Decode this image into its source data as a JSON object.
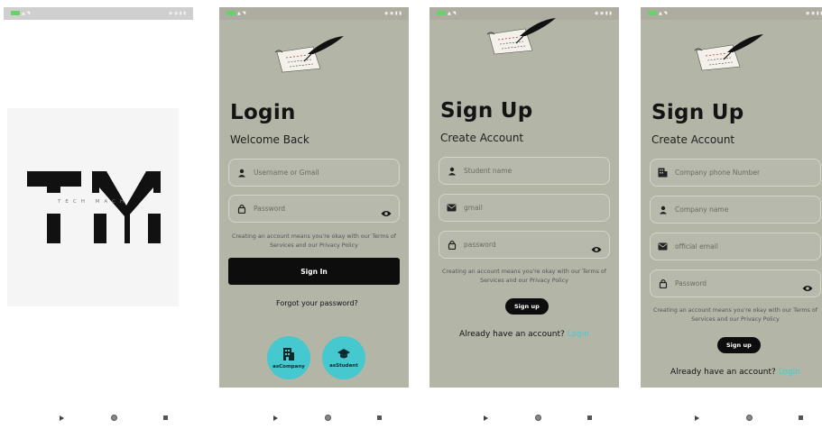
{
  "splash": {
    "brand": "TECH MACH"
  },
  "login": {
    "title": "Login",
    "subtitle": "Welcome Back",
    "username_placeholder": "Username or Gmail",
    "password_placeholder": "Password",
    "terms": "Creating an account means you're okay with our Terms of Services and our Privacy Policy",
    "signin_label": "Sign In",
    "forgot_label": "Forgot your password?",
    "company_label": "asCompany",
    "student_label": "asStudent"
  },
  "signup_student": {
    "title": "Sign Up",
    "subtitle": "Create Account",
    "name_placeholder": "Student name",
    "gmail_placeholder": "gmail",
    "password_placeholder": "password",
    "terms": "Creating an account means you're okay with our Terms of Services and our Privacy Policy",
    "signup_label": "Sign up",
    "already_text": "Already have an account?",
    "login_link": "Login"
  },
  "signup_company": {
    "title": "Sign Up",
    "subtitle": "Create Account",
    "phone_placeholder": "Company phone Number",
    "name_placeholder": "Company name",
    "email_placeholder": "official email",
    "password_placeholder": "Password",
    "terms": "Creating an account means you're okay with our Terms of Services and our Privacy Policy",
    "signup_label": "Sign up",
    "already_text": "Already have an account?",
    "login_link": "Login"
  },
  "colors": {
    "screen_bg": "#b3b5a7",
    "accent": "#45c8ce",
    "button": "#0d0d0d"
  }
}
